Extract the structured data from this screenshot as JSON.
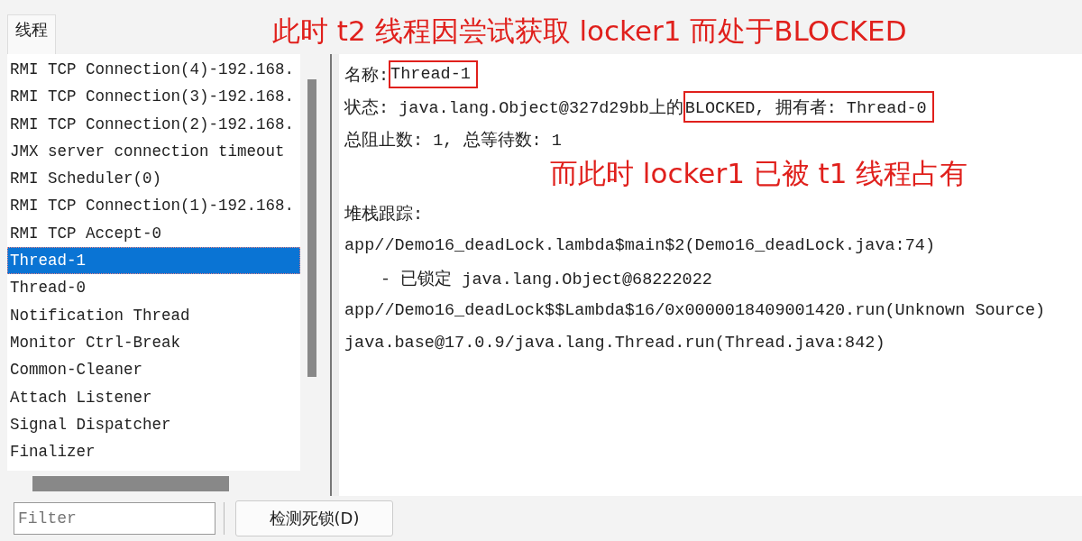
{
  "tabs": [
    {
      "label": "线程",
      "selected": true
    }
  ],
  "annotation_top": "此时 t2 线程因尝试获取 locker1 而处于BLOCKED",
  "threads": [
    {
      "name": "RMI TCP Connection(4)-192.168.",
      "selected": false
    },
    {
      "name": "RMI TCP Connection(3)-192.168.",
      "selected": false
    },
    {
      "name": "RMI TCP Connection(2)-192.168.",
      "selected": false
    },
    {
      "name": "JMX server connection timeout",
      "selected": false
    },
    {
      "name": "RMI Scheduler(0)",
      "selected": false
    },
    {
      "name": "RMI TCP Connection(1)-192.168.",
      "selected": false
    },
    {
      "name": "RMI TCP Accept-0",
      "selected": false
    },
    {
      "name": "Thread-1",
      "selected": true
    },
    {
      "name": "Thread-0",
      "selected": false
    },
    {
      "name": "Notification Thread",
      "selected": false
    },
    {
      "name": "Monitor Ctrl-Break",
      "selected": false
    },
    {
      "name": "Common-Cleaner",
      "selected": false
    },
    {
      "name": "Attach Listener",
      "selected": false
    },
    {
      "name": "Signal Dispatcher",
      "selected": false
    },
    {
      "name": "Finalizer",
      "selected": false
    }
  ],
  "details": {
    "name_label": "名称:",
    "name_value": "Thread-1",
    "state_label": "状态:",
    "state_prefix": "java.lang.Object@327d29bb上的",
    "state_highlight": "BLOCKED, 拥有者: Thread-0",
    "counts": "总阻止数: 1, 总等待数: 1",
    "annotation": "而此时 locker1 已被 t1 线程占有",
    "stack_label": "堆栈跟踪:",
    "stack": [
      {
        "kind": "frame",
        "text": "app//Demo16_deadLock.lambda$main$2(Demo16_deadLock.java:74)"
      },
      {
        "kind": "lock",
        "text": "- 已锁定 java.lang.Object@68222022"
      },
      {
        "kind": "frame",
        "text": "app//Demo16_deadLock$$Lambda$16/0x0000018409001420.run(Unknown Source)"
      },
      {
        "kind": "frame",
        "text": "java.base@17.0.9/java.lang.Thread.run(Thread.java:842)"
      }
    ]
  },
  "filter": {
    "placeholder": "Filter"
  },
  "buttons": [
    "检测死锁(D)"
  ]
}
